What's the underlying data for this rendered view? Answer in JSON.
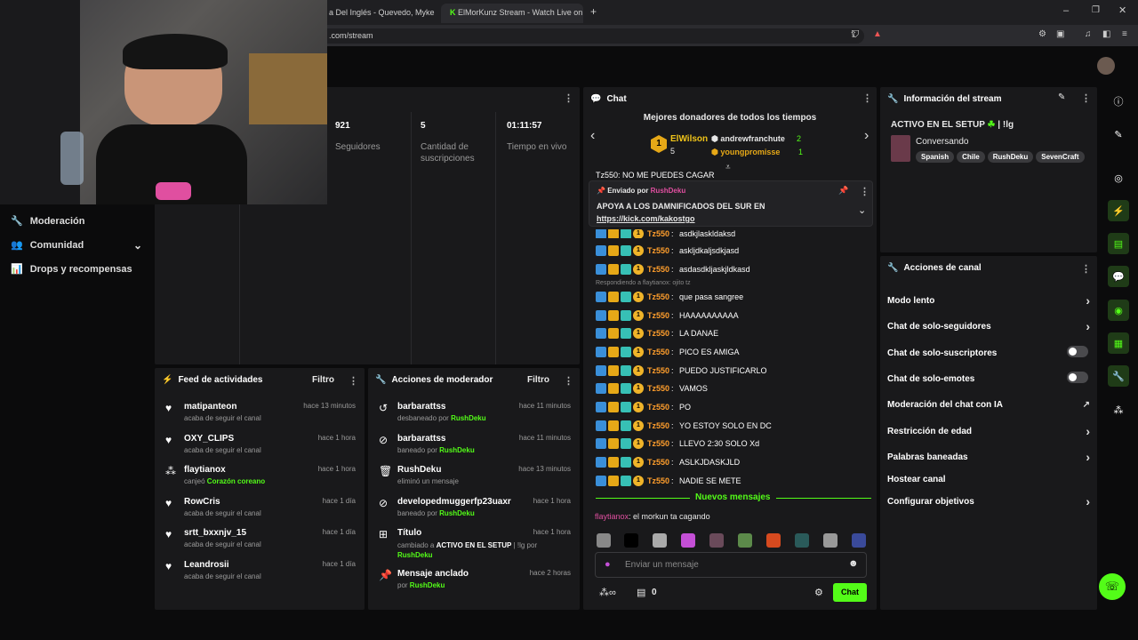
{
  "browser": {
    "tabs": [
      {
        "label": "a Del Inglés - Quevedo, Myke To"
      },
      {
        "label": "ElMorKunz Stream - Watch Live on K"
      }
    ],
    "new_tab": "+",
    "url": ".com/stream"
  },
  "sidebar": {
    "items": [
      {
        "label": "Moderación",
        "icon": "wrench-icon"
      },
      {
        "label": "Comunidad",
        "icon": "people-icon"
      },
      {
        "label": "Drops y recompensas",
        "icon": "gift-icon"
      }
    ]
  },
  "stats": [
    {
      "value": "921",
      "label": "Seguidores"
    },
    {
      "value": "5",
      "label": "Cantidad de suscripciones"
    },
    {
      "value": "01:11:57",
      "label": "Tiempo en vivo"
    }
  ],
  "activity": {
    "title": "Feed de actividades",
    "filter": "Filtro",
    "items": [
      {
        "name": "matipanteon",
        "desc": "acaba de seguir el canal",
        "time": "hace 13 minutos",
        "icon": "heart-icon"
      },
      {
        "name": "OXY_CLIPS",
        "desc": "acaba de seguir el canal",
        "time": "hace 1 hora",
        "icon": "heart-icon"
      },
      {
        "name": "flaytianox",
        "desc_pre": "canjeó ",
        "desc_hl": "Corazón coreano",
        "time": "hace 1 hora",
        "icon": "points-icon"
      },
      {
        "name": "RowCris",
        "desc": "acaba de seguir el canal",
        "time": "hace 1 día",
        "icon": "heart-icon"
      },
      {
        "name": "srtt_bxxnjv_15",
        "desc": "acaba de seguir el canal",
        "time": "hace 1 día",
        "icon": "heart-icon"
      },
      {
        "name": "Leandrosii",
        "desc": "acaba de seguir el canal",
        "time": "hace 1 día",
        "icon": "heart-icon"
      }
    ]
  },
  "modactions": {
    "title": "Acciones de moderador",
    "filter": "Filtro",
    "items": [
      {
        "name": "barbarattss",
        "desc": "desbaneado por ",
        "by": "RushDeku",
        "time": "hace 11 minutos",
        "icon": "undo-icon"
      },
      {
        "name": "barbarattss",
        "desc": "baneado por ",
        "by": "RushDeku",
        "time": "hace 11 minutos",
        "icon": "ban-icon"
      },
      {
        "name": "RushDeku",
        "desc": "eliminó un mensaje",
        "by": "",
        "time": "hace 13 minutos",
        "icon": "trash-icon"
      },
      {
        "name": "developedmuggerfp23uaxr",
        "desc": "baneado por ",
        "by": "RushDeku",
        "time": "hace 1 hora",
        "icon": "ban-icon"
      },
      {
        "name": "Título",
        "desc": "cambiado a ",
        "hl": "ACTIVO EN EL SETUP",
        "desc2": " | !lg por",
        "by": "RushDeku",
        "time": "hace 1 hora",
        "icon": "title-icon"
      },
      {
        "name": "Mensaje anclado",
        "desc": "por ",
        "by": "RushDeku",
        "time": "hace 2 horas",
        "icon": "pin-icon"
      }
    ]
  },
  "chat": {
    "title": "Chat",
    "donors_title": "Mejores donadores de todos los tiempos",
    "donor1": {
      "name": "ElWilson",
      "count": "5"
    },
    "donor2": {
      "name": "andrewfranchute",
      "count": "2"
    },
    "donor3": {
      "name": "youngpromisse",
      "count": "1"
    },
    "top_partial": "Tz550: NO ME PUEDES CAGAR",
    "pinned": {
      "label": "Enviado por",
      "by": "RushDeku",
      "text": "APOYA A LOS DAMNIFICADOS DEL SUR EN",
      "link": "https://kick.com/kakostgo"
    },
    "reply_hint": "Respondiendo a flaytianox: ojito tz",
    "messages": [
      {
        "user": "Tz550",
        "text": "asdkjlaskldaksd"
      },
      {
        "user": "Tz550",
        "text": "asklj​dkaljsdkjasd"
      },
      {
        "user": "Tz550",
        "text": "asdasdkljaskjldkasd"
      },
      {
        "user": "Tz550",
        "text": "que pasa sangree"
      },
      {
        "user": "Tz550",
        "text": "HAAAAAAAAAA"
      },
      {
        "user": "Tz550",
        "text": "LA DANAE"
      },
      {
        "user": "Tz550",
        "text": "PICO ES AMIGA"
      },
      {
        "user": "Tz550",
        "text": "PUEDO JUSTIFICARLO"
      },
      {
        "user": "Tz550",
        "text": "VAMOS"
      },
      {
        "user": "Tz550",
        "text": "PO"
      },
      {
        "user": "Tz550",
        "text": "YO ESTOY SOLO EN DC"
      },
      {
        "user": "Tz550",
        "text": "LLEVO 2:30 SOLO Xd"
      },
      {
        "user": "Tz550",
        "text": "ASLKJDASKJLD"
      },
      {
        "user": "Tz550",
        "text": "NADIE SE METE"
      }
    ],
    "new_messages": "Nuevos mensajes",
    "last": {
      "user": "flaytianox",
      "text": ": el morkun ta cagando"
    },
    "input_placeholder": "Enviar un mensaje",
    "points": "0",
    "send": "Chat"
  },
  "stream_info": {
    "title": "Información del stream",
    "stream_title": "ACTIVO EN EL SETUP",
    "stream_title_suffix": " | !lg",
    "category": "Conversando",
    "tags": [
      "Spanish",
      "Chile",
      "RushDeku",
      "SevenCraft"
    ]
  },
  "channel_actions": {
    "title": "Acciones de canal",
    "items": [
      {
        "label": "Modo lento",
        "control": "chevron"
      },
      {
        "label": "Chat de solo-seguidores",
        "control": "chevron"
      },
      {
        "label": "Chat de solo-suscriptores",
        "control": "toggle"
      },
      {
        "label": "Chat de solo-emotes",
        "control": "toggle"
      },
      {
        "label": "Moderación del chat con IA",
        "control": "external"
      },
      {
        "label": "Restricción de edad",
        "control": "chevron"
      },
      {
        "label": "Palabras baneadas",
        "control": "chevron"
      },
      {
        "label": "Hostear canal",
        "control": "none"
      },
      {
        "label": "Configurar objetivos",
        "control": "chevron"
      }
    ]
  },
  "colors": {
    "accent": "#53fc18",
    "panel": "#19191b",
    "username": "#ff9e2c"
  }
}
